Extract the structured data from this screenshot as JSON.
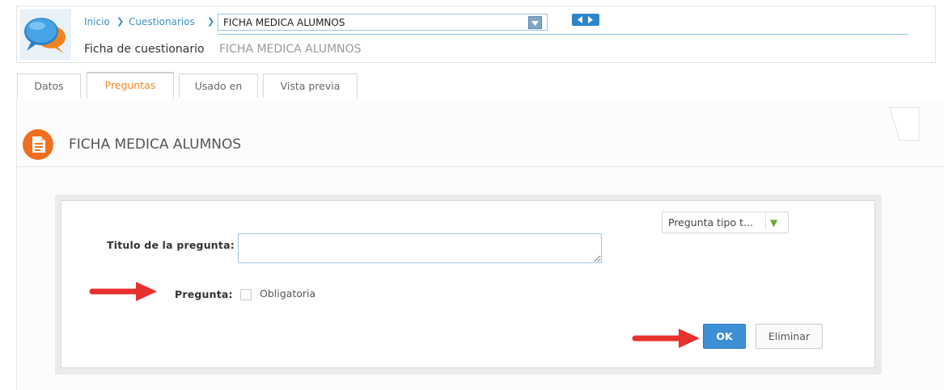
{
  "header": {
    "breadcrumb": {
      "home": "Inicio",
      "section": "Cuestionarios",
      "separator": ">"
    },
    "selected_questionnaire": "FICHA MEDICA ALUMNOS",
    "subtitle_label": "Ficha de cuestionario",
    "subtitle_name": "FICHA MEDICA ALUMNOS"
  },
  "tabs": [
    {
      "label": "Datos",
      "active": false
    },
    {
      "label": "Preguntas",
      "active": true
    },
    {
      "label": "Usado en",
      "active": false
    },
    {
      "label": "Vista previa",
      "active": false
    }
  ],
  "section": {
    "title": "FICHA MEDICA ALUMNOS",
    "icon": "document-list-icon"
  },
  "form": {
    "type_select": "Pregunta tipo t...",
    "title_label": "Titulo de la pregunta:",
    "title_value": "",
    "question_label": "Pregunta:",
    "required_label": "Obligatoria",
    "required_checked": false,
    "ok_label": "OK",
    "delete_label": "Eliminar"
  },
  "colors": {
    "link_blue": "#3d8ec6",
    "active_tab_orange": "#f08a24",
    "section_icon_orange": "#ef6e1f",
    "ok_button_blue": "#3d8fd6",
    "annotation_red": "#e8302f",
    "dropdown_arrow_green": "#6aaa3a"
  }
}
